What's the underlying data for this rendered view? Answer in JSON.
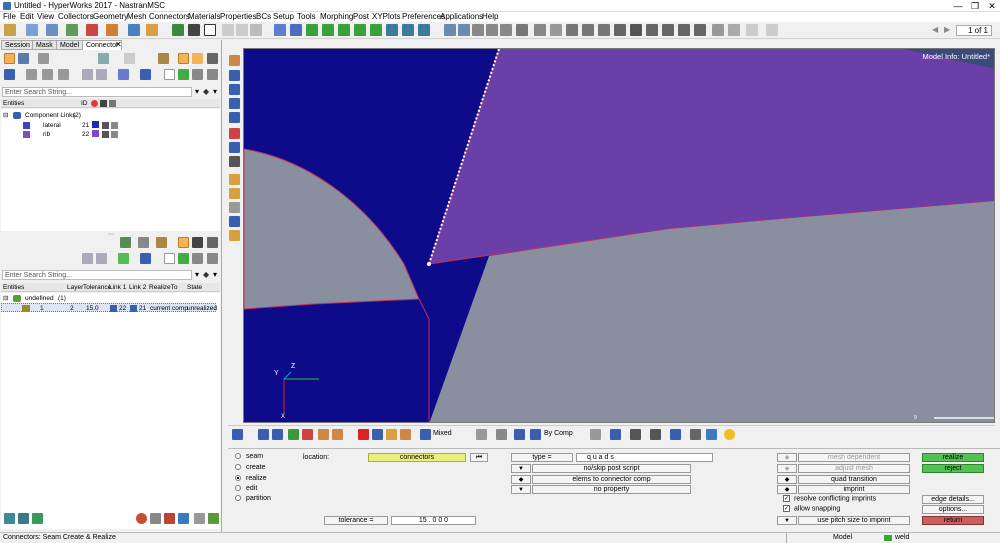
{
  "window": {
    "title": "Untitled - HyperWorks 2017 - NastranMSC",
    "minimize": "—",
    "maximize": "❐",
    "close": "✕"
  },
  "menu": [
    "File",
    "Edit",
    "View",
    "Collectors",
    "Geometry",
    "Mesh",
    "Connectors",
    "Materials",
    "Properties",
    "BCs",
    "Setup",
    "Tools",
    "Morphing",
    "Post",
    "XYPlots",
    "Preferences",
    "Applications",
    "Help"
  ],
  "toolbar": {
    "page_value": "1 of 1"
  },
  "tabs": [
    {
      "label": "Session",
      "active": false
    },
    {
      "label": "Mask",
      "active": false
    },
    {
      "label": "Model",
      "active": false
    },
    {
      "label": "Connector",
      "active": true
    }
  ],
  "top_browser": {
    "search_placeholder": "Enter Search String...",
    "columns": [
      "Entities",
      "ID"
    ],
    "group": {
      "label": "Component Links",
      "count": "(2)"
    },
    "items": [
      {
        "name": "lateral",
        "id": "21",
        "color": "#1d2bb8"
      },
      {
        "name": "rib",
        "id": "22",
        "color": "#7b4fc4"
      }
    ]
  },
  "bottom_browser": {
    "search_placeholder": "Enter Search String...",
    "columns": [
      "Entities",
      "Layer",
      "Tolerance",
      "Link 1",
      "Link 2",
      "RealizeTo",
      "State"
    ],
    "group": {
      "label": "undefined",
      "count": "(1)"
    },
    "row": {
      "entity": "1",
      "layer": "2",
      "tolerance": "15.0",
      "link1": "22",
      "link2": "21",
      "realize_to": "current comp",
      "state": "unrealized"
    }
  },
  "viewport": {
    "model_info": "Model Info: Untitled*",
    "axis_y": "Y",
    "axis_z": "Z",
    "axis_x": "X",
    "scale_label": "9",
    "colors": {
      "background": "#0d0b8a",
      "rib": "#6b3fa8",
      "lateral": "#8a8fa0"
    }
  },
  "viewbar": {
    "display_mode": "Mixed",
    "color_mode": "By Comp"
  },
  "panel": {
    "radios": [
      {
        "label": "seam",
        "selected": false
      },
      {
        "label": "create",
        "selected": false
      },
      {
        "label": "realize",
        "selected": true
      },
      {
        "label": "edit",
        "selected": false
      },
      {
        "label": "partition",
        "selected": false
      }
    ],
    "location_label": "location:",
    "location_value": "connectors",
    "tolerance_label": "tolerance =",
    "tolerance_value": "15 . 0 0 0",
    "type_label": "type =",
    "type_value": "q u a d s",
    "opt1": "no/skip post script",
    "opt2": "elems to connector comp",
    "opt3": "no property",
    "mesh_dependent": "mesh dependent",
    "adjust_mesh": "adjust mesh",
    "quad_transition": "quad transition",
    "imprint": "imprint",
    "resolve_conflicting": "resolve conflicting imprints",
    "allow_snapping": "allow snapping",
    "use_pitch": "use pitch size to imprint",
    "realize_btn": "realize",
    "reject_btn": "reject",
    "edge_details": "edge details...",
    "options_btn": "options...",
    "return_btn": "return"
  },
  "status": {
    "message": "Connectors: Seam Create & Realize",
    "model": "Model",
    "collector": "weld"
  }
}
